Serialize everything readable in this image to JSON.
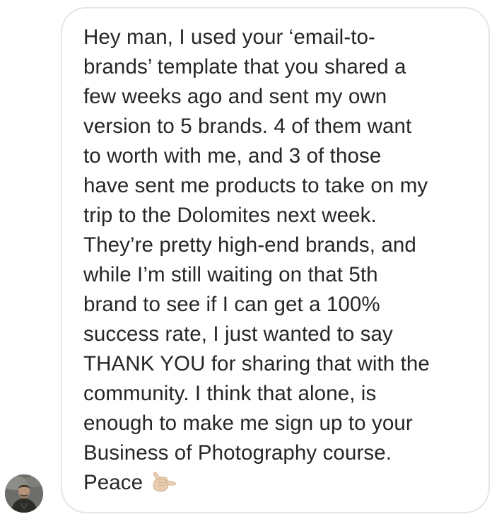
{
  "message": {
    "lines": [
      "Hey man, I used your ‘email-to-",
      "brands’ template that you shared a",
      "few weeks ago and sent my own",
      "version to 5 brands. 4 of them want",
      "to worth with me, and 3 of those",
      "have sent me products to take on my",
      "trip to the Dolomites next week.",
      "They’re pretty high-end brands, and",
      "while I’m still waiting on that 5th",
      "brand to see if I can get a 100%",
      "success rate, I just wanted to say",
      "THANK YOU for sharing that with the",
      "community. I think that alone, is",
      "enough to make me sign up to your",
      "Business of Photography course.",
      "Peace"
    ],
    "emoji": "call-me-hand-emoji"
  },
  "sender": {
    "avatar": "sender-avatar-photo"
  },
  "colors": {
    "text": "#262626",
    "bubble_border": "#e6e6e6",
    "background": "#ffffff"
  }
}
